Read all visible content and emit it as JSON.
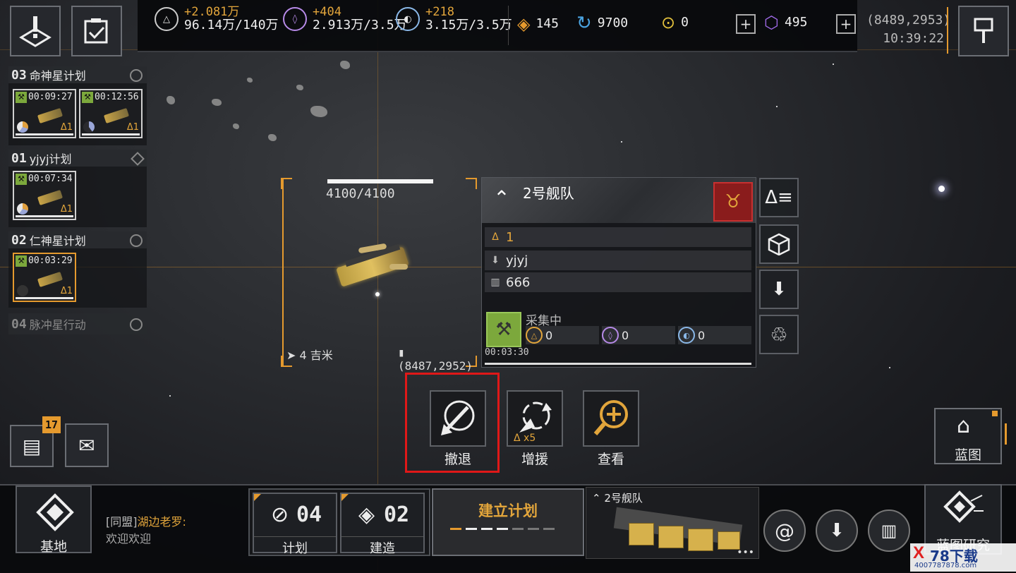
{
  "top": {
    "resources": [
      {
        "icon": "triangle-ore-icon",
        "gain": "+2.081万",
        "amount": "96.14万/140万"
      },
      {
        "icon": "crystal-icon",
        "gain": "+404",
        "amount": "2.913万/3.5万"
      },
      {
        "icon": "gas-icon",
        "gain": "+218",
        "amount": "3.15万/3.5万"
      }
    ],
    "rank_value": "145",
    "credits": "9700",
    "tokens": "0",
    "premium": "495",
    "coords": "(8489,2953)",
    "clock": "10:39:22"
  },
  "plans": [
    {
      "num": "03",
      "name": "命神星计划",
      "timers": [
        "00:09:27",
        "00:12:56"
      ],
      "level": "1"
    },
    {
      "num": "01",
      "name": "yjyj计划",
      "timers": [
        "00:07:34"
      ],
      "level": "1"
    },
    {
      "num": "02",
      "name": "仁神星计划",
      "timers": [
        "00:03:29"
      ],
      "level": "1"
    },
    {
      "num": "04",
      "name": "脉冲星行动"
    }
  ],
  "target": {
    "hp": "4100/4100",
    "hp_fraction": 1.0,
    "distance": "4 吉米",
    "coords": "(8487,2952)"
  },
  "fleet": {
    "name": "2号舰队",
    "level": "1",
    "owner": "yjyj",
    "power": "666",
    "status": "采集中",
    "gather_values": [
      "0",
      "0",
      "0"
    ],
    "elapsed": "00:03:30"
  },
  "actions": [
    {
      "label": "撤退",
      "icon": "retreat-icon"
    },
    {
      "label": "增援",
      "icon": "reinforce-icon",
      "badge": "x5"
    },
    {
      "label": "查看",
      "icon": "view-icon"
    }
  ],
  "blueprint_label": "蓝图",
  "notifications_badge": "17",
  "bottom": {
    "base_label": "基地",
    "chat_channel": "[同盟]",
    "chat_user": "湖边老罗:",
    "chat_message": "欢迎欢迎",
    "plan_count": "04",
    "plan_label": "计划",
    "build_count": "02",
    "build_label": "建造",
    "create_plan": "建立计划",
    "fleet_preview": "2号舰队",
    "research_label": "蓝图研究",
    "watermark": "78下载",
    "watermark_url": "4007787878.com"
  }
}
